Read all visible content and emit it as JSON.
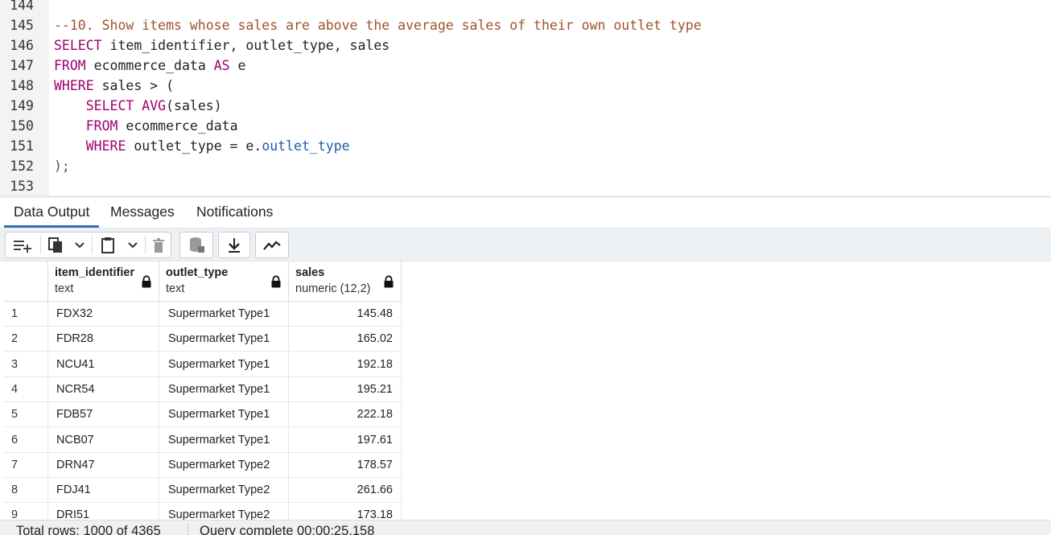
{
  "editor": {
    "lines": [
      {
        "n": "144",
        "parts": []
      },
      {
        "n": "145",
        "parts": [
          {
            "t": "--10. Show items whose sales are above the average sales of their own outlet type",
            "c": "cm"
          }
        ]
      },
      {
        "n": "146",
        "parts": [
          {
            "t": "SELECT",
            "c": "kw"
          },
          {
            "t": " item_identifier, outlet_type, sales",
            "c": ""
          }
        ]
      },
      {
        "n": "147",
        "parts": [
          {
            "t": "FROM",
            "c": "kw"
          },
          {
            "t": " ecommerce_data ",
            "c": ""
          },
          {
            "t": "AS",
            "c": "kw"
          },
          {
            "t": " e",
            "c": ""
          }
        ]
      },
      {
        "n": "148",
        "parts": [
          {
            "t": "WHERE",
            "c": "kw"
          },
          {
            "t": " sales > (",
            "c": ""
          }
        ]
      },
      {
        "n": "149",
        "parts": [
          {
            "t": "    ",
            "c": ""
          },
          {
            "t": "SELECT",
            "c": "kw"
          },
          {
            "t": " ",
            "c": ""
          },
          {
            "t": "AVG",
            "c": "fn"
          },
          {
            "t": "(sales)",
            "c": ""
          }
        ]
      },
      {
        "n": "150",
        "parts": [
          {
            "t": "    ",
            "c": ""
          },
          {
            "t": "FROM",
            "c": "kw"
          },
          {
            "t": " ecommerce_data",
            "c": ""
          }
        ]
      },
      {
        "n": "151",
        "parts": [
          {
            "t": "    ",
            "c": ""
          },
          {
            "t": "WHERE",
            "c": "kw"
          },
          {
            "t": " outlet_type = e.",
            "c": ""
          },
          {
            "t": "outlet_type",
            "c": "prop"
          }
        ]
      },
      {
        "n": "152",
        "parts": [
          {
            "t": ");",
            "c": "pn"
          }
        ]
      },
      {
        "n": "153",
        "parts": []
      }
    ]
  },
  "tabs": {
    "data_output": "Data Output",
    "messages": "Messages",
    "notifications": "Notifications"
  },
  "toolbar": {
    "icons": [
      "add-row-icon",
      "copy-icon",
      "dropdown-icon",
      "paste-icon",
      "dropdown-icon",
      "delete-icon",
      "save-data-icon",
      "download-icon",
      "graph-icon"
    ]
  },
  "grid": {
    "columns": [
      {
        "name": "item_identifier",
        "type": "text"
      },
      {
        "name": "outlet_type",
        "type": "text"
      },
      {
        "name": "sales",
        "type": "numeric (12,2)"
      }
    ],
    "rows": [
      {
        "n": "1",
        "item": "FDX32",
        "outlet": "Supermarket Type1",
        "sales": "145.48"
      },
      {
        "n": "2",
        "item": "FDR28",
        "outlet": "Supermarket Type1",
        "sales": "165.02"
      },
      {
        "n": "3",
        "item": "NCU41",
        "outlet": "Supermarket Type1",
        "sales": "192.18"
      },
      {
        "n": "4",
        "item": "NCR54",
        "outlet": "Supermarket Type1",
        "sales": "195.21"
      },
      {
        "n": "5",
        "item": "FDB57",
        "outlet": "Supermarket Type1",
        "sales": "222.18"
      },
      {
        "n": "6",
        "item": "NCB07",
        "outlet": "Supermarket Type1",
        "sales": "197.61"
      },
      {
        "n": "7",
        "item": "DRN47",
        "outlet": "Supermarket Type2",
        "sales": "178.57"
      },
      {
        "n": "8",
        "item": "FDJ41",
        "outlet": "Supermarket Type2",
        "sales": "261.66"
      },
      {
        "n": "9",
        "item": "DRI51",
        "outlet": "Supermarket Type2",
        "sales": "173.18"
      }
    ]
  },
  "status": {
    "total_rows": "Total rows: 1000 of 4365",
    "query": "Query complete 00:00:25.158"
  }
}
